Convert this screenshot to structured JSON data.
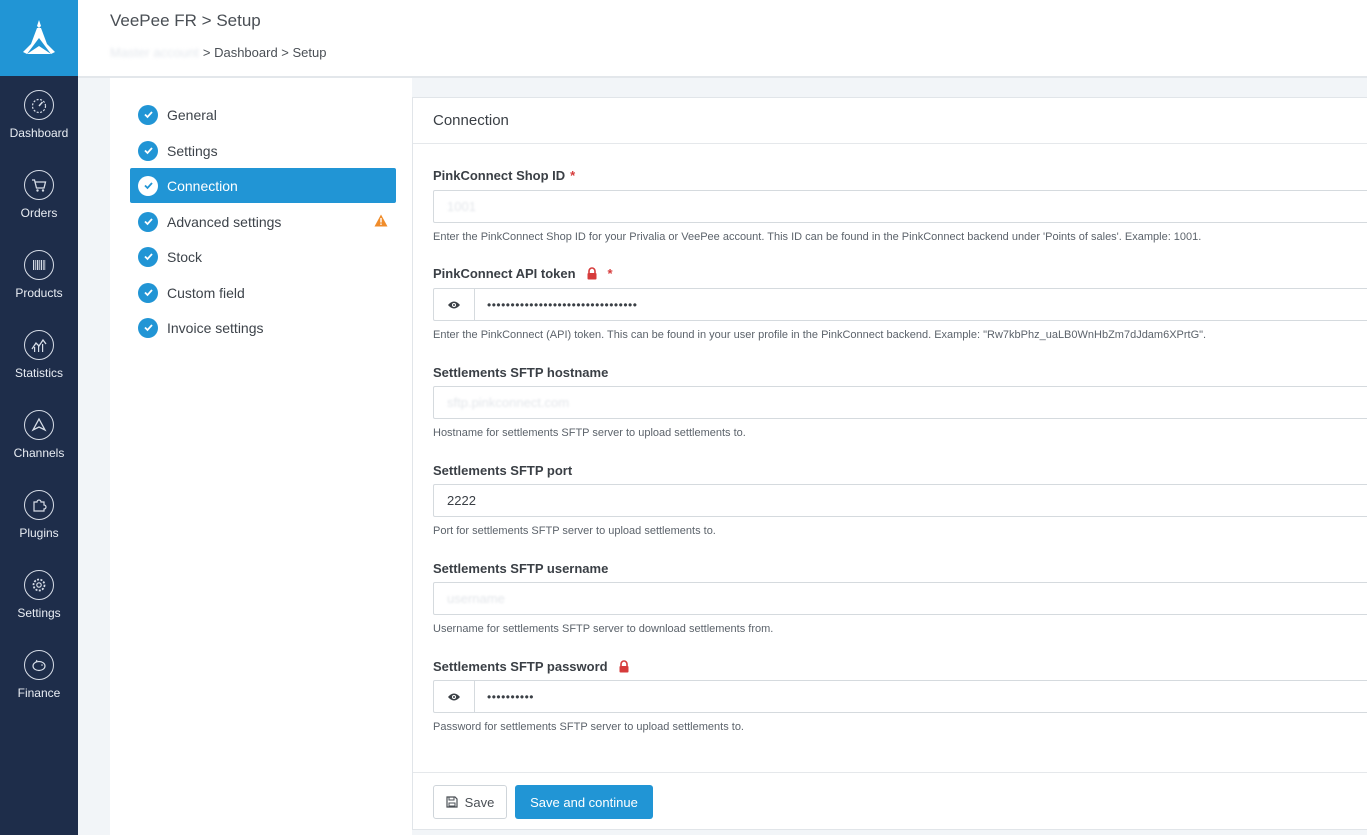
{
  "nav": {
    "logo": "logo-icon",
    "items": [
      {
        "label": "Dashboard",
        "icon": "speedometer-icon"
      },
      {
        "label": "Orders",
        "icon": "cart-icon"
      },
      {
        "label": "Products",
        "icon": "barcode-icon"
      },
      {
        "label": "Statistics",
        "icon": "chart-icon"
      },
      {
        "label": "Channels",
        "icon": "channels-icon"
      },
      {
        "label": "Plugins",
        "icon": "puzzle-icon"
      },
      {
        "label": "Settings",
        "icon": "gear-icon"
      },
      {
        "label": "Finance",
        "icon": "piggy-bank-icon"
      }
    ]
  },
  "header": {
    "title": "VeePee FR > Setup",
    "breadcrumb_blurred": "Master account",
    "breadcrumb_rest": "> Dashboard > Setup"
  },
  "steps": [
    {
      "label": "General",
      "active": false
    },
    {
      "label": "Settings",
      "active": false
    },
    {
      "label": "Connection",
      "active": true
    },
    {
      "label": "Advanced settings",
      "active": false,
      "warning": true
    },
    {
      "label": "Stock",
      "active": false
    },
    {
      "label": "Custom field",
      "active": false
    },
    {
      "label": "Invoice settings",
      "active": false
    }
  ],
  "panel": {
    "title": "Connection",
    "fields": {
      "shop_id": {
        "label": "PinkConnect Shop ID",
        "required": "*",
        "value": "1001",
        "help": "Enter the PinkConnect Shop ID for your Privalia or VeePee account. This ID can be found in the PinkConnect backend under 'Points of sales'. Example: 1001."
      },
      "api_token": {
        "label": "PinkConnect API token",
        "required": "*",
        "value": "••••••••••••••••••••••••••••••••",
        "help": "Enter the PinkConnect (API) token. This can be found in your user profile in the PinkConnect backend. Example: \"Rw7kbPhz_uaLB0WnHbZm7dJdam6XPrtG\"."
      },
      "sftp_hostname": {
        "label": "Settlements SFTP hostname",
        "value": "sftp.pinkconnect.com",
        "help": "Hostname for settlements SFTP server to upload settlements to."
      },
      "sftp_port": {
        "label": "Settlements SFTP port",
        "value": "2222",
        "help": "Port for settlements SFTP server to upload settlements to."
      },
      "sftp_username": {
        "label": "Settlements SFTP username",
        "value": "username",
        "help": "Username for settlements SFTP server to download settlements from."
      },
      "sftp_password": {
        "label": "Settlements SFTP password",
        "value": "••••••••••",
        "help": "Password for settlements SFTP server to upload settlements to."
      }
    },
    "buttons": {
      "save": "Save",
      "save_continue": "Save and continue"
    }
  },
  "colors": {
    "nav_bg": "#1e2d4a",
    "accent": "#2195d5",
    "required": "#d63b3b",
    "warning": "#f08c2a"
  }
}
